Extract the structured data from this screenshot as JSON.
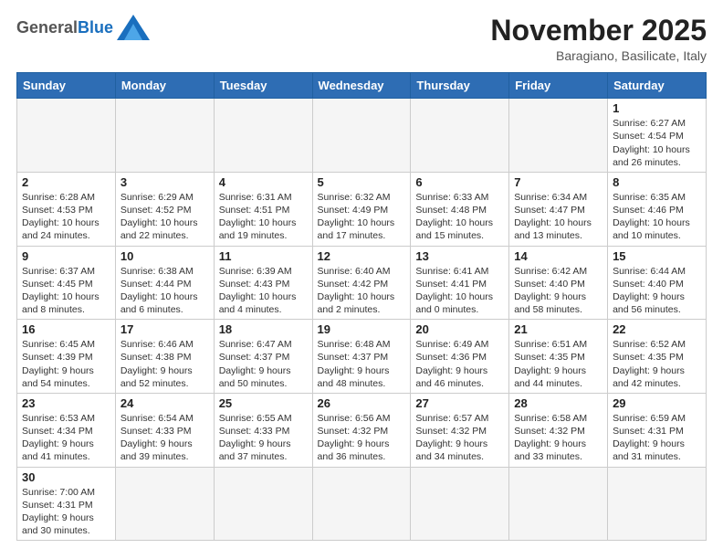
{
  "header": {
    "logo_general": "General",
    "logo_blue": "Blue",
    "month_year": "November 2025",
    "location": "Baragiano, Basilicate, Italy"
  },
  "days_of_week": [
    "Sunday",
    "Monday",
    "Tuesday",
    "Wednesday",
    "Thursday",
    "Friday",
    "Saturday"
  ],
  "weeks": [
    [
      {
        "day": "",
        "info": ""
      },
      {
        "day": "",
        "info": ""
      },
      {
        "day": "",
        "info": ""
      },
      {
        "day": "",
        "info": ""
      },
      {
        "day": "",
        "info": ""
      },
      {
        "day": "",
        "info": ""
      },
      {
        "day": "1",
        "info": "Sunrise: 6:27 AM\nSunset: 4:54 PM\nDaylight: 10 hours\nand 26 minutes."
      }
    ],
    [
      {
        "day": "2",
        "info": "Sunrise: 6:28 AM\nSunset: 4:53 PM\nDaylight: 10 hours\nand 24 minutes."
      },
      {
        "day": "3",
        "info": "Sunrise: 6:29 AM\nSunset: 4:52 PM\nDaylight: 10 hours\nand 22 minutes."
      },
      {
        "day": "4",
        "info": "Sunrise: 6:31 AM\nSunset: 4:51 PM\nDaylight: 10 hours\nand 19 minutes."
      },
      {
        "day": "5",
        "info": "Sunrise: 6:32 AM\nSunset: 4:49 PM\nDaylight: 10 hours\nand 17 minutes."
      },
      {
        "day": "6",
        "info": "Sunrise: 6:33 AM\nSunset: 4:48 PM\nDaylight: 10 hours\nand 15 minutes."
      },
      {
        "day": "7",
        "info": "Sunrise: 6:34 AM\nSunset: 4:47 PM\nDaylight: 10 hours\nand 13 minutes."
      },
      {
        "day": "8",
        "info": "Sunrise: 6:35 AM\nSunset: 4:46 PM\nDaylight: 10 hours\nand 10 minutes."
      }
    ],
    [
      {
        "day": "9",
        "info": "Sunrise: 6:37 AM\nSunset: 4:45 PM\nDaylight: 10 hours\nand 8 minutes."
      },
      {
        "day": "10",
        "info": "Sunrise: 6:38 AM\nSunset: 4:44 PM\nDaylight: 10 hours\nand 6 minutes."
      },
      {
        "day": "11",
        "info": "Sunrise: 6:39 AM\nSunset: 4:43 PM\nDaylight: 10 hours\nand 4 minutes."
      },
      {
        "day": "12",
        "info": "Sunrise: 6:40 AM\nSunset: 4:42 PM\nDaylight: 10 hours\nand 2 minutes."
      },
      {
        "day": "13",
        "info": "Sunrise: 6:41 AM\nSunset: 4:41 PM\nDaylight: 10 hours\nand 0 minutes."
      },
      {
        "day": "14",
        "info": "Sunrise: 6:42 AM\nSunset: 4:40 PM\nDaylight: 9 hours\nand 58 minutes."
      },
      {
        "day": "15",
        "info": "Sunrise: 6:44 AM\nSunset: 4:40 PM\nDaylight: 9 hours\nand 56 minutes."
      }
    ],
    [
      {
        "day": "16",
        "info": "Sunrise: 6:45 AM\nSunset: 4:39 PM\nDaylight: 9 hours\nand 54 minutes."
      },
      {
        "day": "17",
        "info": "Sunrise: 6:46 AM\nSunset: 4:38 PM\nDaylight: 9 hours\nand 52 minutes."
      },
      {
        "day": "18",
        "info": "Sunrise: 6:47 AM\nSunset: 4:37 PM\nDaylight: 9 hours\nand 50 minutes."
      },
      {
        "day": "19",
        "info": "Sunrise: 6:48 AM\nSunset: 4:37 PM\nDaylight: 9 hours\nand 48 minutes."
      },
      {
        "day": "20",
        "info": "Sunrise: 6:49 AM\nSunset: 4:36 PM\nDaylight: 9 hours\nand 46 minutes."
      },
      {
        "day": "21",
        "info": "Sunrise: 6:51 AM\nSunset: 4:35 PM\nDaylight: 9 hours\nand 44 minutes."
      },
      {
        "day": "22",
        "info": "Sunrise: 6:52 AM\nSunset: 4:35 PM\nDaylight: 9 hours\nand 42 minutes."
      }
    ],
    [
      {
        "day": "23",
        "info": "Sunrise: 6:53 AM\nSunset: 4:34 PM\nDaylight: 9 hours\nand 41 minutes."
      },
      {
        "day": "24",
        "info": "Sunrise: 6:54 AM\nSunset: 4:33 PM\nDaylight: 9 hours\nand 39 minutes."
      },
      {
        "day": "25",
        "info": "Sunrise: 6:55 AM\nSunset: 4:33 PM\nDaylight: 9 hours\nand 37 minutes."
      },
      {
        "day": "26",
        "info": "Sunrise: 6:56 AM\nSunset: 4:32 PM\nDaylight: 9 hours\nand 36 minutes."
      },
      {
        "day": "27",
        "info": "Sunrise: 6:57 AM\nSunset: 4:32 PM\nDaylight: 9 hours\nand 34 minutes."
      },
      {
        "day": "28",
        "info": "Sunrise: 6:58 AM\nSunset: 4:32 PM\nDaylight: 9 hours\nand 33 minutes."
      },
      {
        "day": "29",
        "info": "Sunrise: 6:59 AM\nSunset: 4:31 PM\nDaylight: 9 hours\nand 31 minutes."
      }
    ],
    [
      {
        "day": "30",
        "info": "Sunrise: 7:00 AM\nSunset: 4:31 PM\nDaylight: 9 hours\nand 30 minutes."
      },
      {
        "day": "",
        "info": ""
      },
      {
        "day": "",
        "info": ""
      },
      {
        "day": "",
        "info": ""
      },
      {
        "day": "",
        "info": ""
      },
      {
        "day": "",
        "info": ""
      },
      {
        "day": "",
        "info": ""
      }
    ]
  ]
}
